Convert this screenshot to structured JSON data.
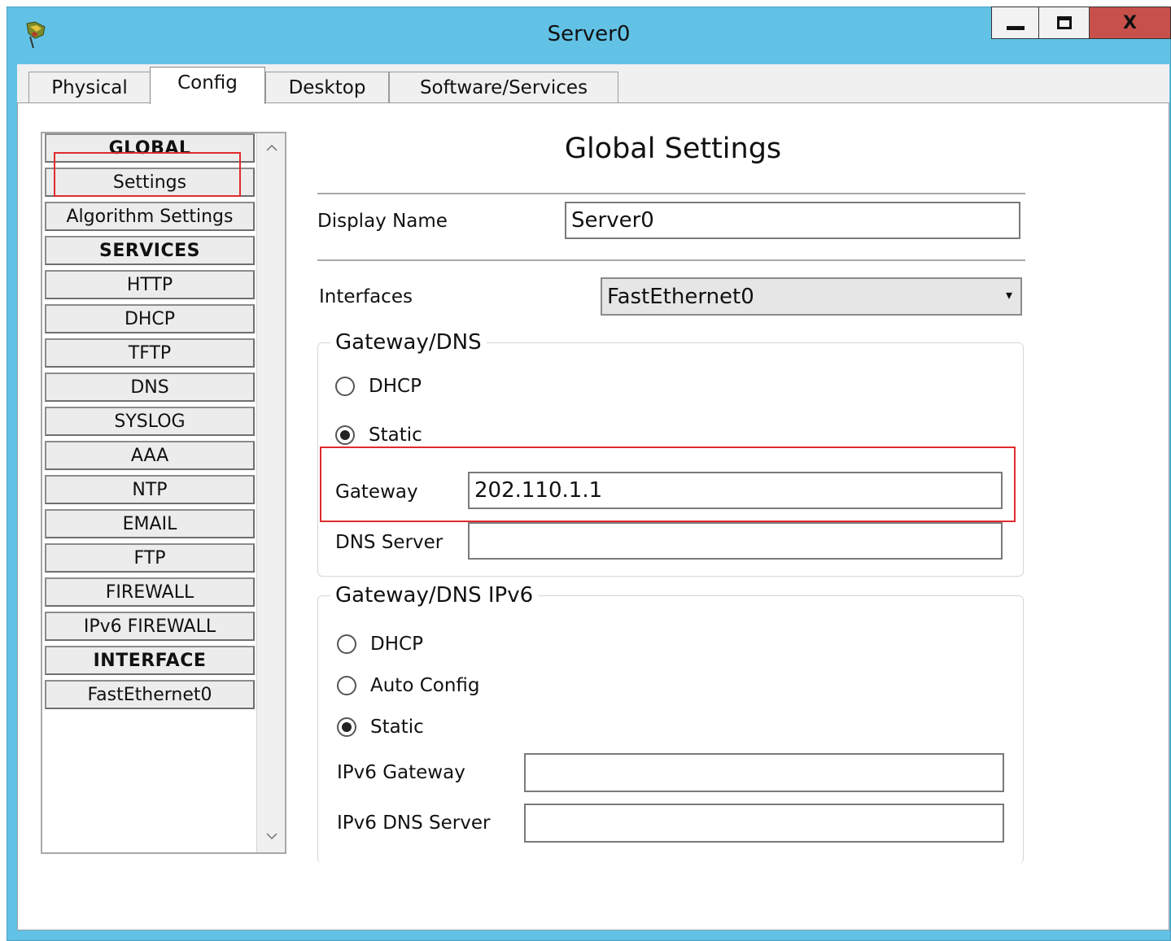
{
  "window": {
    "title": "Server0",
    "close_glyph": "X",
    "icon": "packet-tracer-server-icon"
  },
  "tabs": [
    {
      "label": "Physical",
      "active": false
    },
    {
      "label": "Config",
      "active": true
    },
    {
      "label": "Desktop",
      "active": false
    },
    {
      "label": "Software/Services",
      "active": false
    }
  ],
  "sidebar": {
    "items": [
      {
        "label": "GLOBAL",
        "type": "header"
      },
      {
        "label": "Settings",
        "type": "item",
        "selected": true
      },
      {
        "label": "Algorithm Settings",
        "type": "item"
      },
      {
        "label": "SERVICES",
        "type": "header"
      },
      {
        "label": "HTTP",
        "type": "item"
      },
      {
        "label": "DHCP",
        "type": "item"
      },
      {
        "label": "TFTP",
        "type": "item"
      },
      {
        "label": "DNS",
        "type": "item"
      },
      {
        "label": "SYSLOG",
        "type": "item"
      },
      {
        "label": "AAA",
        "type": "item"
      },
      {
        "label": "NTP",
        "type": "item"
      },
      {
        "label": "EMAIL",
        "type": "item"
      },
      {
        "label": "FTP",
        "type": "item"
      },
      {
        "label": "FIREWALL",
        "type": "item"
      },
      {
        "label": "IPv6 FIREWALL",
        "type": "item"
      },
      {
        "label": "INTERFACE",
        "type": "header"
      },
      {
        "label": "FastEthernet0",
        "type": "item"
      }
    ]
  },
  "main": {
    "title": "Global Settings",
    "display_name": {
      "label": "Display Name",
      "value": "Server0"
    },
    "interfaces": {
      "label": "Interfaces",
      "selected": "FastEthernet0"
    },
    "gateway_dns": {
      "legend": "Gateway/DNS",
      "dhcp_label": "DHCP",
      "static_label": "Static",
      "selected": "Static",
      "gateway_label": "Gateway",
      "gateway_value": "202.110.1.1",
      "dns_label": "DNS Server",
      "dns_value": ""
    },
    "gateway_dns_ipv6": {
      "legend": "Gateway/DNS IPv6",
      "dhcp_label": "DHCP",
      "auto_label": "Auto Config",
      "static_label": "Static",
      "selected": "Static",
      "gateway_label": "IPv6 Gateway",
      "gateway_value": "",
      "dns_label": "IPv6 DNS Server",
      "dns_value": ""
    }
  },
  "colors": {
    "titlebar": "#62c2e6",
    "close_button": "#c7514a",
    "highlight": "#e02b2b"
  }
}
